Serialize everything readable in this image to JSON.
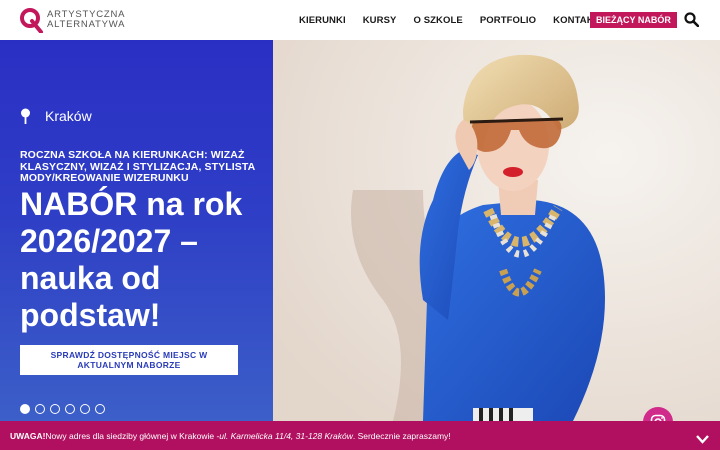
{
  "logo": {
    "line1": "ARTYSTYCZNA",
    "line2": "ALTERNATYWA",
    "icon": "aa-logo-icon",
    "color": "#c2185b"
  },
  "nav": {
    "items": [
      {
        "label": "KIERUNKI"
      },
      {
        "label": "KURSY"
      },
      {
        "label": "O SZKOLE"
      },
      {
        "label": "PORTFOLIO"
      },
      {
        "label": "KONTAKT"
      }
    ],
    "cta_label": "BIEŻĄCY NABÓR",
    "search_icon": "search-icon"
  },
  "hero": {
    "location": "Kraków",
    "pin_icon": "location-pin-icon",
    "subtitle": "ROCZNA SZKOŁA NA KIERUNKACH: WIZAŻ KLASYCZNY, WIZAŻ I STYLIZACJA, STYLISTA MODY/KREOWANIE WIZERUNKU",
    "headline": "NABÓR na rok 2026/2027 – nauka od podstaw!",
    "button_label": "SPRAWDŹ DOSTĘPNOŚĆ MIEJSC W AKTUALNYM NABORZE",
    "slides_total": 6,
    "active_slide": 1,
    "bg_color": "#2a2fc4"
  },
  "notice": {
    "label": "UWAGA!",
    "text1": " Nowy adres dla siedziby głównej w Krakowie - ",
    "address": "ul. Karmelicka 11/4, 31-128 Kraków",
    "text2": ". Serdecznie zapraszamy!",
    "bg_color": "#b0105f",
    "close_icon": "close-icon"
  },
  "social": {
    "icon": "instagram-icon"
  }
}
